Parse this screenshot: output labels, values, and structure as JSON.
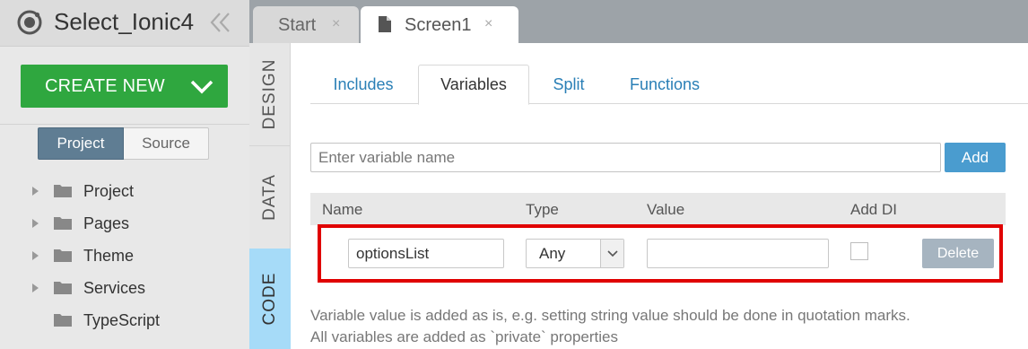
{
  "app": {
    "title": "Select_Ionic4",
    "logo_icon": "ionic-logo-icon",
    "collapse_icon": "double-chevron-left-icon"
  },
  "create": {
    "label": "CREATE NEW",
    "dropdown_icon": "chevron-down-icon",
    "color": "#2fa73f"
  },
  "segments": {
    "project": "Project",
    "source": "Source",
    "active": "Project"
  },
  "tree": [
    {
      "label": "Project",
      "expandable": true
    },
    {
      "label": "Pages",
      "expandable": true
    },
    {
      "label": "Theme",
      "expandable": true
    },
    {
      "label": "Services",
      "expandable": true
    },
    {
      "label": "TypeScript",
      "expandable": false
    }
  ],
  "doc_tabs": [
    {
      "label": "Start",
      "close": "×",
      "active": false
    },
    {
      "label": "Screen1",
      "close": "×",
      "active": true,
      "icon": "file-icon"
    }
  ],
  "mode_tabs": {
    "design": "DESIGN",
    "data": "DATA",
    "code": "CODE",
    "active": "CODE"
  },
  "sub_tabs": {
    "includes": "Includes",
    "variables": "Variables",
    "split": "Split",
    "functions": "Functions",
    "active": "Variables"
  },
  "new_variable": {
    "placeholder": "Enter variable name",
    "value": "",
    "add_label": "Add"
  },
  "table": {
    "headers": {
      "name": "Name",
      "type": "Type",
      "value": "Value",
      "add_di": "Add DI"
    },
    "rows": [
      {
        "name": "optionsList",
        "type": "Any",
        "value": "",
        "add_di": false,
        "delete_label": "Delete"
      }
    ]
  },
  "hints": {
    "line1": "Variable value is added as is, e.g. setting string value should be done in quotation marks.",
    "line2": "All variables are added as `private` properties"
  },
  "colors": {
    "accent": "#2a7fb6",
    "highlight": "#e00000",
    "code_tab": "#a6dbf8"
  }
}
